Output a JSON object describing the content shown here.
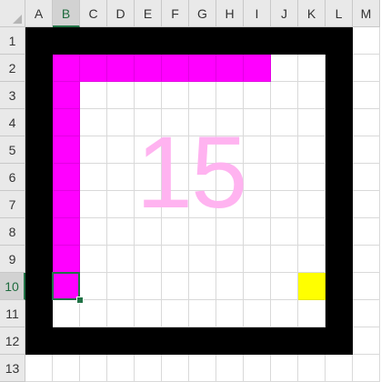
{
  "columns": [
    "A",
    "B",
    "C",
    "D",
    "E",
    "F",
    "G",
    "H",
    "I",
    "J",
    "K",
    "L",
    "M"
  ],
  "rows": [
    "1",
    "2",
    "3",
    "4",
    "5",
    "6",
    "7",
    "8",
    "9",
    "10",
    "11",
    "12",
    "13"
  ],
  "selected_cell": "B10",
  "board": {
    "number": "15",
    "colors": {
      "border": "#000000",
      "snake": "#ff00ff",
      "food": "#ffff00",
      "number": "#ffb3f0",
      "selection": "#217346"
    },
    "wall_cells": "rows 1-12 x columns A-L frame (rows 1 and 12, columns A and L)",
    "snake_cells": [
      "I2",
      "H2",
      "G2",
      "F2",
      "E2",
      "D2",
      "C2",
      "B2",
      "B3",
      "B4",
      "B5",
      "B6",
      "B7",
      "B8",
      "B9",
      "B10"
    ],
    "snake_head": "B10",
    "food_cell": "K10"
  }
}
